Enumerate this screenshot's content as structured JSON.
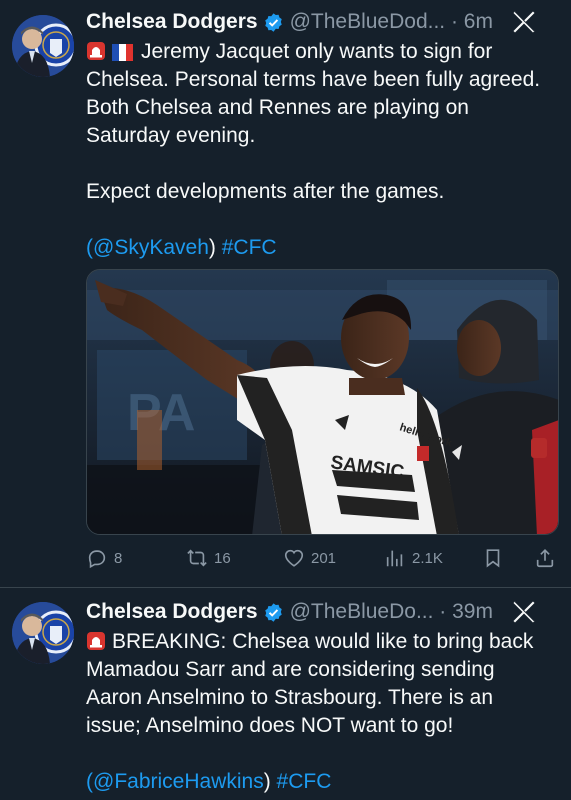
{
  "colors": {
    "background": "#15202b",
    "link": "#1d9bf0",
    "muted": "#8b98a5",
    "verified": "#1d9bf0"
  },
  "tweets": [
    {
      "name": "Chelsea Dodgers",
      "handle_time": "@TheBlueDod... · 6m",
      "lines": [
        "Jeremy Jacquet only wants to sign for",
        "Chelsea. Personal terms have been fully agreed.",
        "Both Chelsea and Rennes are playing on",
        "Saturday evening.",
        "Expect developments after the games."
      ],
      "mention": "@SkyKaveh",
      "hashtag": "#CFC",
      "photo": {
        "sponsor_shirt": "SAMSIC",
        "sponsor_top": "hello work"
      },
      "stats": {
        "replies": "8",
        "reposts": "16",
        "likes": "201",
        "views": "2.1K"
      }
    },
    {
      "name": "Chelsea Dodgers",
      "handle_time": "@TheBlueDo... · 39m",
      "lines": [
        "BREAKING: Chelsea would like to bring back",
        "Mamadou Sarr and are considering sending",
        "Aaron Anselmino to Strasbourg. There is an",
        "issue; Anselmino does NOT want to go!"
      ],
      "mention": "@FabriceHawkins",
      "hashtag": "#CFC"
    }
  ]
}
